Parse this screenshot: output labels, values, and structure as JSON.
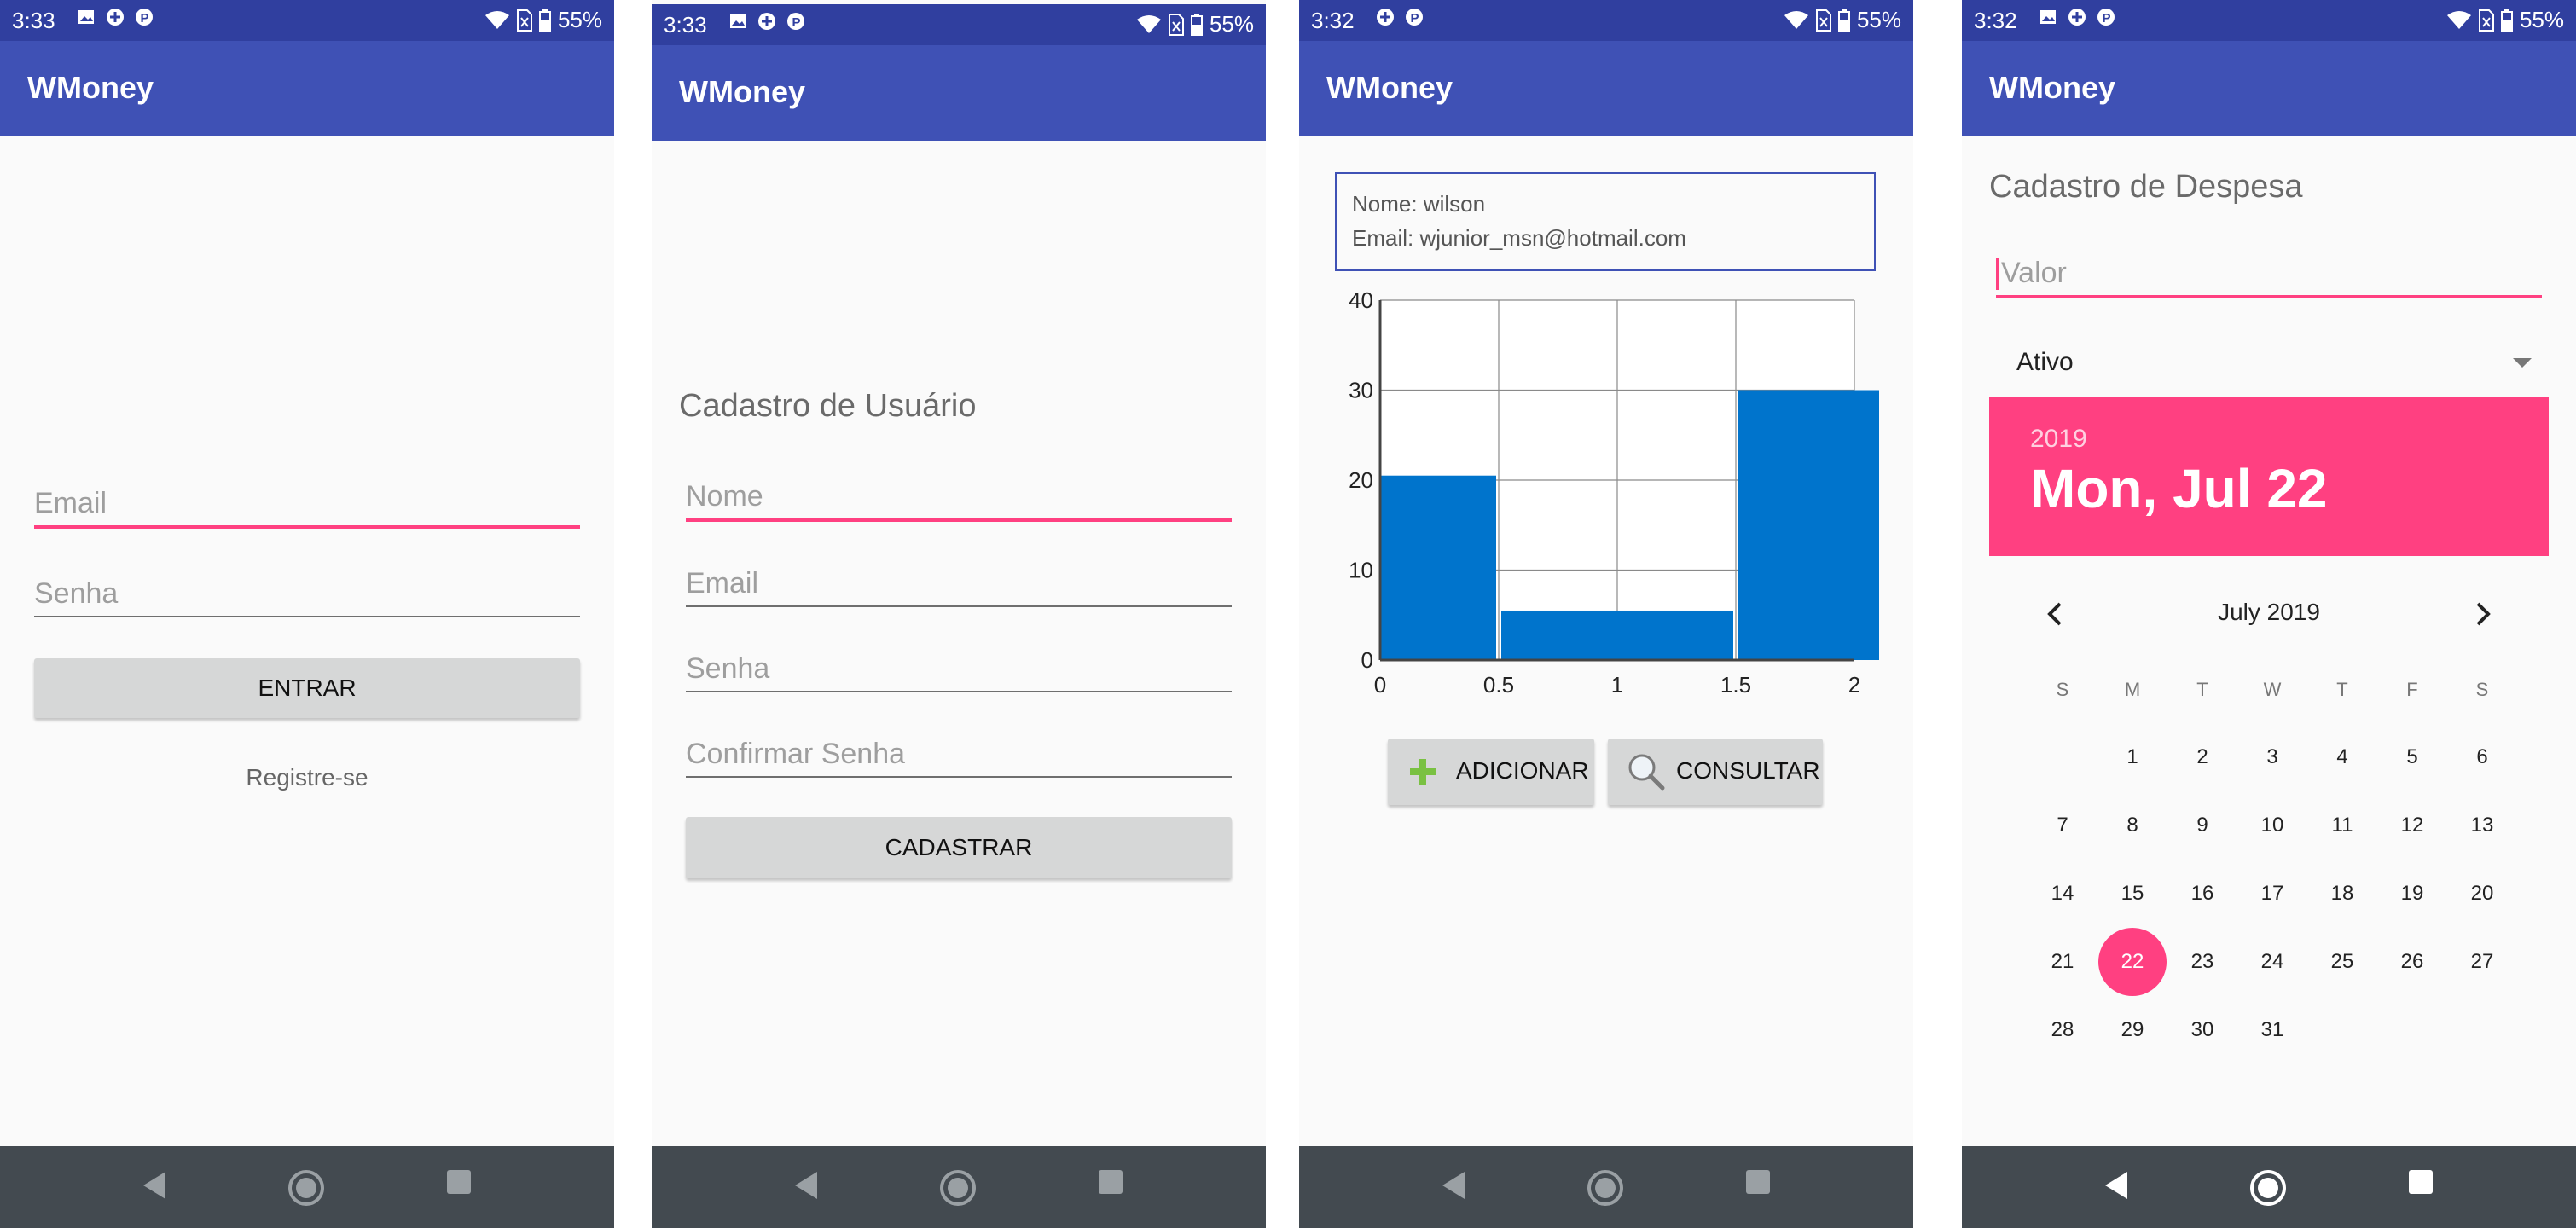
{
  "app_name": "WMoney",
  "accent_color": "#ff4081",
  "primary_color": "#3f51b5",
  "status_icons_left": [
    "image-icon",
    "plus-circle-icon",
    "parking-icon"
  ],
  "status_icons_right": [
    "wifi-icon",
    "sim-card-icon",
    "battery-icon"
  ],
  "screens": [
    {
      "time": "3:33",
      "battery": "55%"
    },
    {
      "time": "3:33",
      "battery": "55%"
    },
    {
      "time": "3:32",
      "battery": "55%"
    },
    {
      "time": "3:32",
      "battery": "55%"
    }
  ],
  "login": {
    "email_placeholder": "Email",
    "password_placeholder": "Senha",
    "enter_button": "ENTRAR",
    "register_link": "Registre-se"
  },
  "register": {
    "heading": "Cadastro de Usuário",
    "name_placeholder": "Nome",
    "email_placeholder": "Email",
    "password_placeholder": "Senha",
    "confirm_placeholder": "Confirmar Senha",
    "submit_button": "CADASTRAR"
  },
  "dashboard": {
    "name_line": "Nome: wilson",
    "email_line": "Email: wjunior_msn@hotmail.com",
    "add_button": "ADICIONAR",
    "query_button": "CONSULTAR"
  },
  "chart_data": {
    "type": "bar",
    "x": [
      0,
      1,
      2
    ],
    "values": [
      20.5,
      5.5,
      30
    ],
    "bar_width": 1,
    "xticks": [
      "0",
      "0.5",
      "1",
      "1.5",
      "2"
    ],
    "yticks": [
      "0",
      "10",
      "20",
      "30",
      "40"
    ],
    "xlim": [
      0,
      2
    ],
    "ylim": [
      0,
      40
    ],
    "grid": true,
    "bar_color": "#0074cc"
  },
  "expense": {
    "heading": "Cadastro de Despesa",
    "value_placeholder": "Valor",
    "selected_option": "Ativo",
    "year": "2019",
    "date_display": "Mon, Jul 22",
    "month_title": "July 2019",
    "weekdays": [
      "S",
      "M",
      "T",
      "W",
      "T",
      "F",
      "S"
    ],
    "weeks": [
      [
        "",
        "1",
        "2",
        "3",
        "4",
        "5",
        "6"
      ],
      [
        "7",
        "8",
        "9",
        "10",
        "11",
        "12",
        "13"
      ],
      [
        "14",
        "15",
        "16",
        "17",
        "18",
        "19",
        "20"
      ],
      [
        "21",
        "22",
        "23",
        "24",
        "25",
        "26",
        "27"
      ],
      [
        "28",
        "29",
        "30",
        "31",
        "",
        "",
        ""
      ]
    ],
    "selected_day": "22"
  }
}
